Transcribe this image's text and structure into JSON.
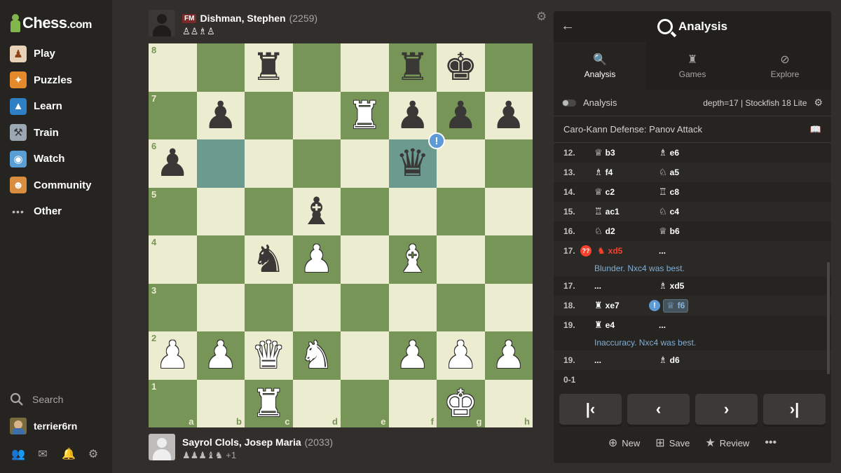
{
  "sidebar": {
    "logo_text": "Chess",
    "logo_suffix": ".com",
    "items": [
      {
        "label": "Play",
        "icon": "hand-pawn-icon",
        "glyph": "♟"
      },
      {
        "label": "Puzzles",
        "icon": "puzzle-icon",
        "glyph": "✦"
      },
      {
        "label": "Learn",
        "icon": "graduation-cap-icon",
        "glyph": "▲"
      },
      {
        "label": "Train",
        "icon": "dumbbell-icon",
        "glyph": "⚒"
      },
      {
        "label": "Watch",
        "icon": "binoculars-icon",
        "glyph": "◉"
      },
      {
        "label": "Community",
        "icon": "people-icon",
        "glyph": "☻"
      },
      {
        "label": "Other",
        "icon": "more-dots-icon",
        "glyph": "•••"
      }
    ],
    "search_label": "Search",
    "username": "terrier6rn"
  },
  "top_player": {
    "title": "FM",
    "name": "Dishman, Stephen",
    "rating": "(2259)",
    "captured": "♙♙♗♙"
  },
  "bottom_player": {
    "name": "Sayrol Clols, Josep Maria",
    "rating": "(2033)",
    "captured": "♟♟♟♝♞",
    "advantage": "+1"
  },
  "board": {
    "ranks": [
      "8",
      "7",
      "6",
      "5",
      "4",
      "3",
      "2",
      "1"
    ],
    "files": [
      "a",
      "b",
      "c",
      "d",
      "e",
      "f",
      "g",
      "h"
    ],
    "position": [
      [
        "",
        "",
        "bR",
        "",
        "",
        "bR",
        "bK",
        ""
      ],
      [
        "",
        "bP",
        "",
        "",
        "wR",
        "bP",
        "bP",
        "bP"
      ],
      [
        "bP",
        "",
        "",
        "",
        "",
        "bQ",
        "",
        ""
      ],
      [
        "",
        "",
        "",
        "bB",
        "",
        "",
        "",
        ""
      ],
      [
        "",
        "",
        "bN",
        "wP",
        "",
        "wB",
        "",
        ""
      ],
      [
        "",
        "",
        "",
        "",
        "",
        "",
        "",
        ""
      ],
      [
        "wP",
        "wP",
        "wQ",
        "wN",
        "",
        "wP",
        "wP",
        "wP"
      ],
      [
        "",
        "",
        "wR",
        "",
        "",
        "",
        "wK",
        ""
      ]
    ],
    "highlighted": [
      "b6",
      "f6"
    ],
    "annotated_square": "f6",
    "annotation": "!"
  },
  "panel": {
    "title": "Analysis",
    "tabs": [
      {
        "label": "Analysis",
        "icon": "analysis-icon"
      },
      {
        "label": "Games",
        "icon": "games-icon"
      },
      {
        "label": "Explore",
        "icon": "compass-icon"
      }
    ],
    "engine_label": "Analysis",
    "engine_info": "depth=17 | Stockfish 18 Lite",
    "opening": "Caro-Kann Defense: Panov Attack",
    "moves": [
      {
        "num": "12.",
        "w_fig": "♕",
        "w": "b3",
        "b_fig": "♗",
        "b": "e6"
      },
      {
        "num": "13.",
        "w_fig": "♗",
        "w": "f4",
        "b_fig": "♘",
        "b": "a5"
      },
      {
        "num": "14.",
        "w_fig": "♕",
        "w": "c2",
        "b_fig": "♖",
        "b": "c8"
      },
      {
        "num": "15.",
        "w_fig": "♖",
        "w": "ac1",
        "b_fig": "♘",
        "b": "c4"
      },
      {
        "num": "16.",
        "w_fig": "♘",
        "w": "d2",
        "b_fig": "♕",
        "b": "b6"
      }
    ],
    "blunder_move": {
      "num": "17.",
      "badge": "??",
      "fig": "♞",
      "w": "xd5",
      "b": "..."
    },
    "blunder_comment": "Blunder. Nxc4 was best.",
    "move17b": {
      "num": "17.",
      "w": "...",
      "b_fig": "♗",
      "b": "xd5"
    },
    "move18": {
      "num": "18.",
      "w_fig": "♜",
      "w": "xe7",
      "badge": "!",
      "b_fig": "♕",
      "b": "f6"
    },
    "move19": {
      "num": "19.",
      "w_fig": "♜",
      "w": "e4",
      "b": "..."
    },
    "inacc_comment": "Inaccuracy. Nxc4 was best.",
    "move19b": {
      "num": "19.",
      "w": "...",
      "b_fig": "♗",
      "b": "d6"
    },
    "result": "0-1",
    "actions": [
      {
        "label": "New",
        "icon": "new-analysis-icon"
      },
      {
        "label": "Save",
        "icon": "save-icon"
      },
      {
        "label": "Review",
        "icon": "star-review-icon"
      }
    ]
  }
}
